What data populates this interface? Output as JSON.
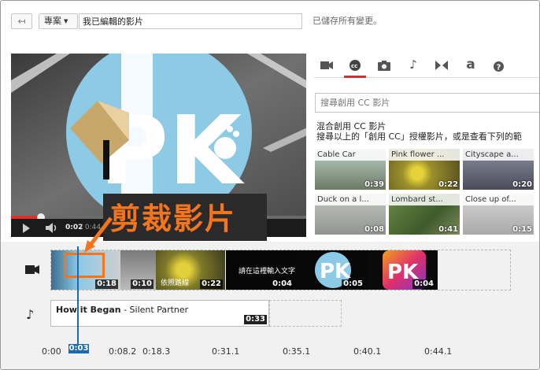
{
  "toolbar": {
    "back_icon": "back-arrow-icon",
    "project_label": "專案",
    "title_value": "我已編輯的影片",
    "save_status": "已儲存所有變更。"
  },
  "player": {
    "current_time": "0:02",
    "total_time": "/ 0:44",
    "progress_fraction": 0.1,
    "logo_text": "PK"
  },
  "callout": {
    "text": "剪裁影片",
    "color": "#f5751e"
  },
  "tabs": [
    {
      "icon": "camera-icon"
    },
    {
      "icon": "cc-icon",
      "active": true
    },
    {
      "icon": "photo-camera-icon"
    },
    {
      "icon": "music-note-icon"
    },
    {
      "icon": "transition-icon"
    },
    {
      "icon": "text-icon",
      "label": "a"
    },
    {
      "icon": "help-icon",
      "label": "?"
    }
  ],
  "search": {
    "placeholder": "搜尋創用 CC 影片"
  },
  "cc": {
    "title": "混合創用 CC 影片",
    "description": "搜尋以上的「創用 CC」授權影片，或是查看下列的範"
  },
  "thumbnails": [
    {
      "title": "Cable Car",
      "duration": "0:39"
    },
    {
      "title": "Pink flower ...",
      "duration": "0:22"
    },
    {
      "title": "Cityscape a...",
      "duration": "0:20"
    },
    {
      "title": "Duck on a l...",
      "duration": "0:08"
    },
    {
      "title": "Lombard st...",
      "duration": "0:41"
    },
    {
      "title": "Close up of...",
      "duration": "0:15"
    }
  ],
  "timeline": {
    "clips": [
      {
        "duration": "0:18",
        "caption": ""
      },
      {
        "duration": "0:10",
        "caption": ""
      },
      {
        "duration": "0:22",
        "caption": "依照路線"
      },
      {
        "duration": "0:04",
        "caption": "請在這裡輸入文字"
      },
      {
        "duration": "0:05",
        "caption": ""
      },
      {
        "duration": "0:04",
        "caption": ""
      }
    ],
    "audio": {
      "title": "How it Began",
      "artist": " - Silent Partner",
      "duration": "0:33"
    },
    "ticks": [
      "0:00",
      "0:08.2",
      "0:18.3",
      "0:31.1",
      "0:35.1",
      "0:40.1",
      "0:44.1"
    ],
    "playhead": "0:03"
  },
  "colors": {
    "accent_red": "#c93535",
    "playhead_blue": "#1c6bb0",
    "highlight_orange": "#f5751e"
  }
}
